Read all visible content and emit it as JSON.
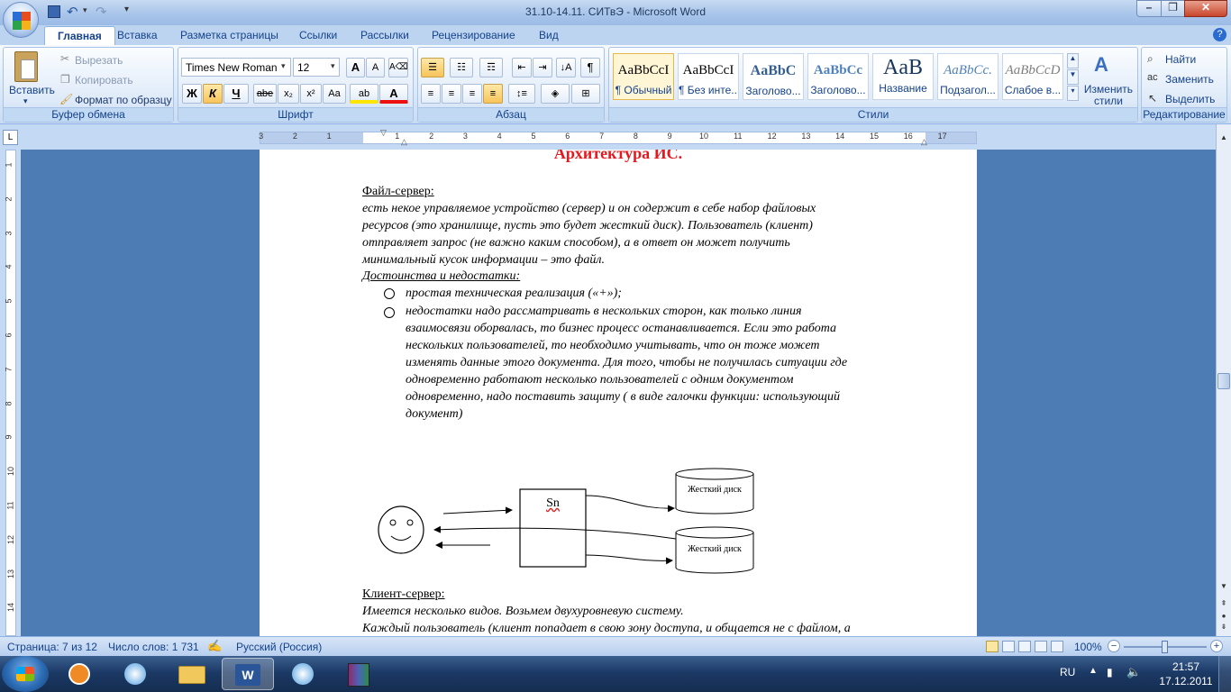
{
  "window": {
    "title": "31.10-14.11. СИТвЭ - Microsoft Word"
  },
  "tabs": [
    "Главная",
    "Вставка",
    "Разметка страницы",
    "Ссылки",
    "Рассылки",
    "Рецензирование",
    "Вид"
  ],
  "clipboard": {
    "paste": "Вставить",
    "cut": "Вырезать",
    "copy": "Копировать",
    "format_painter": "Формат по образцу",
    "label": "Буфер обмена"
  },
  "font": {
    "family": "Times New Roman",
    "size": "12",
    "bold": "Ж",
    "italic": "К",
    "underline": "Ч",
    "strike": "abe",
    "subscript": "x₂",
    "superscript": "x²",
    "case": "Aa",
    "label": "Шрифт"
  },
  "paragraph": {
    "label": "Абзац"
  },
  "styles": {
    "items": [
      {
        "sample": "AaBbCcI",
        "name": "¶ Обычный"
      },
      {
        "sample": "AaBbCcI",
        "name": "¶ Без инте..."
      },
      {
        "sample": "AaBbC",
        "name": "Заголово..."
      },
      {
        "sample": "AaBbCc",
        "name": "Заголово..."
      },
      {
        "sample": "AaB",
        "name": "Название"
      },
      {
        "sample": "AaBbCc.",
        "name": "Подзагол..."
      },
      {
        "sample": "AaBbCcD",
        "name": "Слабое в..."
      }
    ],
    "change": "Изменить стили",
    "label": "Стили"
  },
  "editing": {
    "find": "Найти",
    "replace": "Заменить",
    "select": "Выделить",
    "label": "Редактирование"
  },
  "ruler": {
    "h_marks": [
      "3",
      "2",
      "1",
      "1",
      "2",
      "3",
      "4",
      "5",
      "6",
      "7",
      "8",
      "9",
      "10",
      "11",
      "12",
      "13",
      "14",
      "15",
      "16",
      "17"
    ],
    "v_marks": [
      "1",
      "2",
      "3",
      "4",
      "5",
      "6",
      "7",
      "8",
      "9",
      "10",
      "11",
      "12",
      "13",
      "14"
    ]
  },
  "document": {
    "heading": "Архитектура ИС.",
    "section1_title": "Файл-сервер:",
    "para1_lines": [
      " есть некое управляемое устройство (сервер) и он содержит в себе набор файловых",
      "ресурсов (это хранилище, пусть это будет жесткий диск). Пользователь (клиент)",
      "отправляет запрос (не важно каким способом), а в ответ он может получить",
      "минимальный кусок информации – это файл."
    ],
    "pros_cons_title": " Достоинства и недостатки:",
    "bullet1": "простая техническая реализация («+»);",
    "bullet2_lines": [
      "недостатки надо рассматривать в нескольких сторон, как только линия",
      "взаимосвязи оборвалась, то бизнес процесс останавливается. Если это работа",
      "нескольких пользователей, то необходимо учитывать, что он тоже может",
      "изменять данные этого документа. Для того, чтобы не получилась ситуации где",
      "одновременно работают несколько пользователей с одним документом",
      "одновременно, надо поставить защиту ( в виде галочки функции: использующий",
      "документ)"
    ],
    "diagram": {
      "server_label": "Sn",
      "disk1": "Жесткий диск",
      "disk2": "Жесткий диск"
    },
    "section2_title": "Клиент-сервер:",
    "para2": "Имеется несколько видов. Возьмем двухуровневую систему.",
    "para3": "Каждый пользователь (клиент попадает в свою зону доступа, и общается не с файлом, а"
  },
  "status": {
    "page": "Страница: 7 из 12",
    "words": "Число слов: 1 731",
    "language": "Русский (Россия)",
    "zoom": "100%"
  },
  "taskbar": {
    "lang": "RU",
    "time": "21:57",
    "date": "17.12.2011"
  },
  "colors": {
    "heading": "#e8161d",
    "ribbon_text": "#15428b",
    "word_blue": "#2a5699"
  }
}
